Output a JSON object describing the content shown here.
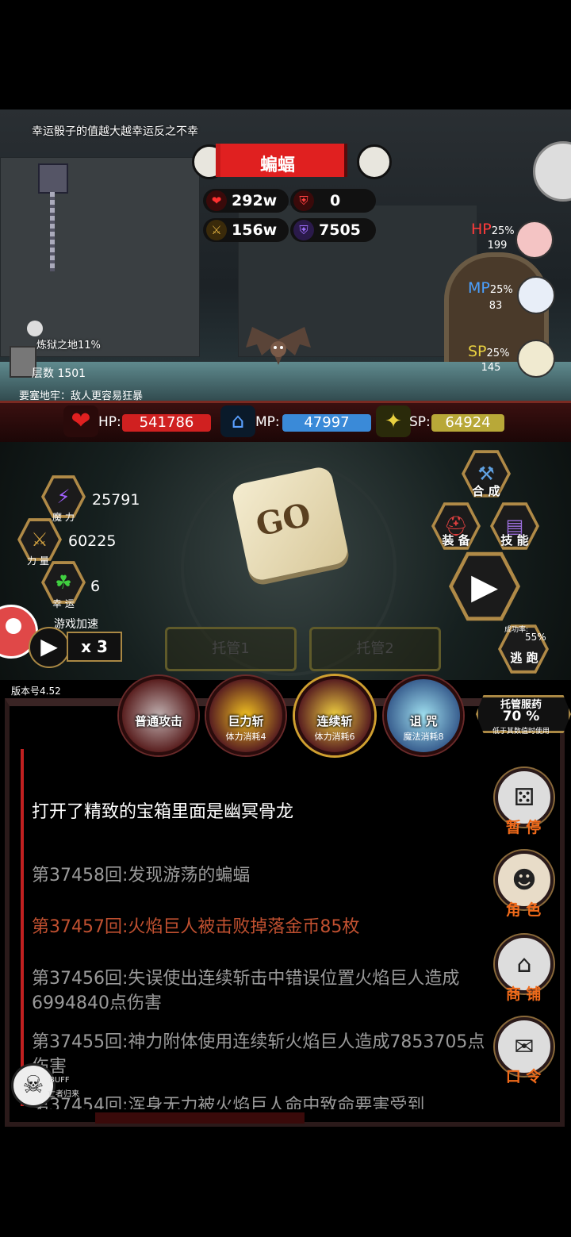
{
  "scene": {
    "tip": "幸运骰子的值越大越幸运反之不幸",
    "enemy_name": "蝙蝠",
    "enemy_stats": {
      "hp": "292w",
      "defense": "0",
      "attack": "156w",
      "magic_def": "7505"
    },
    "area_name": "炼狱之地11%",
    "floor": "层数 1501",
    "fortress_note": "要塞地牢：敌人更容易狂暴",
    "potions": [
      {
        "label": "HP",
        "pct": "25%",
        "count": "199",
        "color": "#ff3a3a"
      },
      {
        "label": "MP",
        "pct": "25%",
        "count": "83",
        "color": "#4aa0ff"
      },
      {
        "label": "SP",
        "pct": "25%",
        "count": "145",
        "color": "#e8d040"
      }
    ]
  },
  "bars": {
    "hp_label": "HP:",
    "hp_value": "541786",
    "mp_label": "MP:",
    "mp_value": "47997",
    "sp_label": "SP:",
    "sp_value": "64924"
  },
  "stats": {
    "magic": {
      "value": "25791",
      "caption": "魔 力"
    },
    "strength": {
      "value": "60225",
      "caption": "力 量"
    },
    "luck": {
      "value": "6",
      "caption": "幸 运"
    }
  },
  "speed": {
    "label": "游戏加速",
    "value": "x 3"
  },
  "version": "版本号4.52",
  "dice_text": "GO",
  "auto_buttons": {
    "auto1": "托管1",
    "auto2": "托管2"
  },
  "right_menu": {
    "craft": "合 成",
    "equip": "装 备",
    "skill": "技 能",
    "flee_rate_label": "成功率:",
    "flee_rate": "55%",
    "flee": "逃 跑"
  },
  "skills": [
    {
      "name": "普通攻击",
      "cost": ""
    },
    {
      "name": "巨力斩",
      "cost": "体力消耗4"
    },
    {
      "name": "连续斩",
      "cost": "体力消耗6"
    },
    {
      "name": "诅 咒",
      "cost": "魔法消耗8"
    }
  ],
  "auto_potion": {
    "title": "托管服药",
    "value": "70 %",
    "sub": "低于其数值时使用"
  },
  "log": [
    {
      "text": "打开了精致的宝箱里面是幽冥骨龙",
      "color": "#ffffff"
    },
    {
      "text": "第37458回:发现游荡的蝙蝠",
      "color": "#9a9a9a"
    },
    {
      "text": "第37457回:火焰巨人被击败掉落金币85枚",
      "color": "#c05030"
    },
    {
      "text": "第37456回:失误使出连续斩击中错误位置火焰巨人造成6994840点伤害",
      "color": "#9a9a9a"
    },
    {
      "text": "第37455回:神力附体使用连续斩火焰巨人造成7853705点伤害",
      "color": "#9a9a9a"
    },
    {
      "text": "第37454回:浑身无力被火焰巨人命中致命要害受到",
      "color": "#9a9a9a"
    }
  ],
  "side_menu": {
    "pause": "暂 停",
    "role": "角 色",
    "shop": "商 铺",
    "code": "口 令"
  },
  "buff": {
    "label": "BUFF",
    "name": "亡者归来"
  }
}
